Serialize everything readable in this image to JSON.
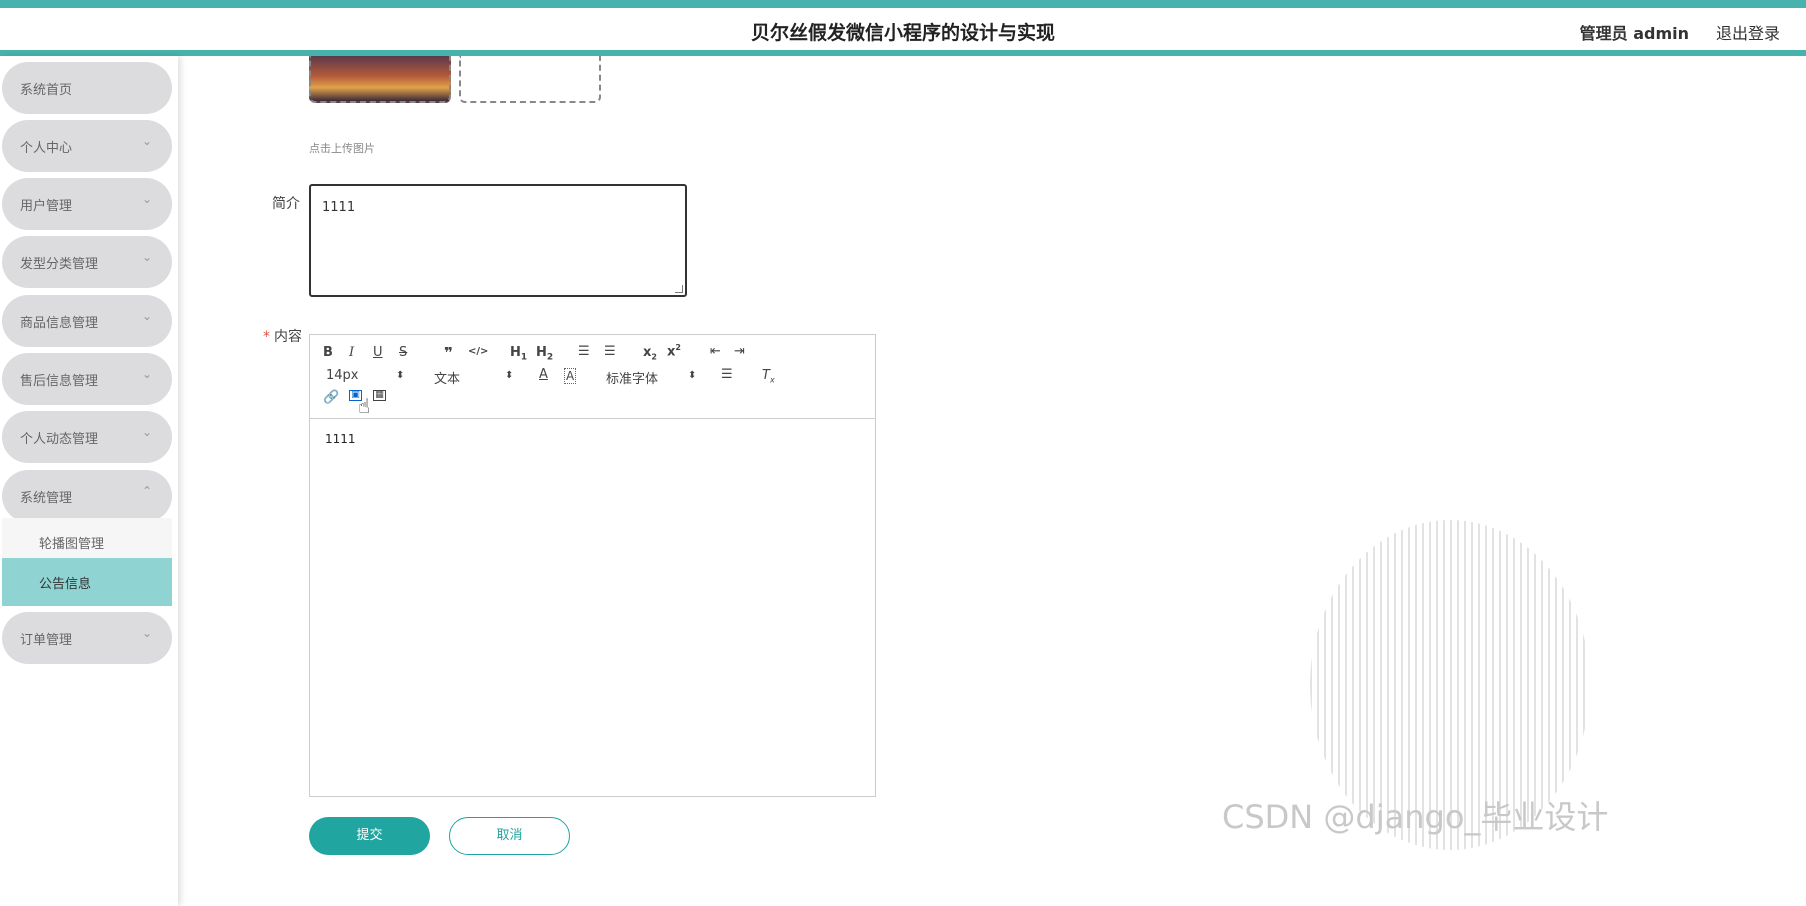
{
  "header": {
    "title": "贝尔丝假发微信小程序的设计与实现",
    "admin_label": "管理员 admin",
    "logout_label": "退出登录"
  },
  "sidebar": {
    "items": [
      {
        "label": "系统首页"
      },
      {
        "label": "个人中心"
      },
      {
        "label": "用户管理"
      },
      {
        "label": "发型分类管理"
      },
      {
        "label": "商品信息管理"
      },
      {
        "label": "售后信息管理"
      },
      {
        "label": "个人动态管理"
      },
      {
        "label": "系统管理"
      },
      {
        "label": "订单管理"
      }
    ],
    "submenu": [
      {
        "label": "轮播图管理"
      },
      {
        "label": "公告信息",
        "active": true
      }
    ]
  },
  "form": {
    "upload_hint": "点击上传图片",
    "intro_label": "简介",
    "intro_value": "1111",
    "content_label": "内容",
    "content_required": "*",
    "content_value": "1111"
  },
  "editor": {
    "font_size": "14px",
    "block_type": "文本",
    "font_family": "标准字体",
    "buttons": [
      "B",
      "I",
      "U",
      "S",
      "❞",
      "</>",
      "H1",
      "H2",
      "ol",
      "ul",
      "x₂",
      "x²",
      "outdent",
      "indent",
      "color",
      "background",
      "align",
      "clean",
      "link",
      "image",
      "video"
    ]
  },
  "actions": {
    "submit_label": "提交",
    "cancel_label": "取消"
  },
  "watermark": "CSDN @django_毕业设计",
  "colors": {
    "accent": "#48b3ac",
    "button": "#20a5a0",
    "active_menu": "#8fd3d3",
    "menu_bg": "#dcdcdf"
  }
}
